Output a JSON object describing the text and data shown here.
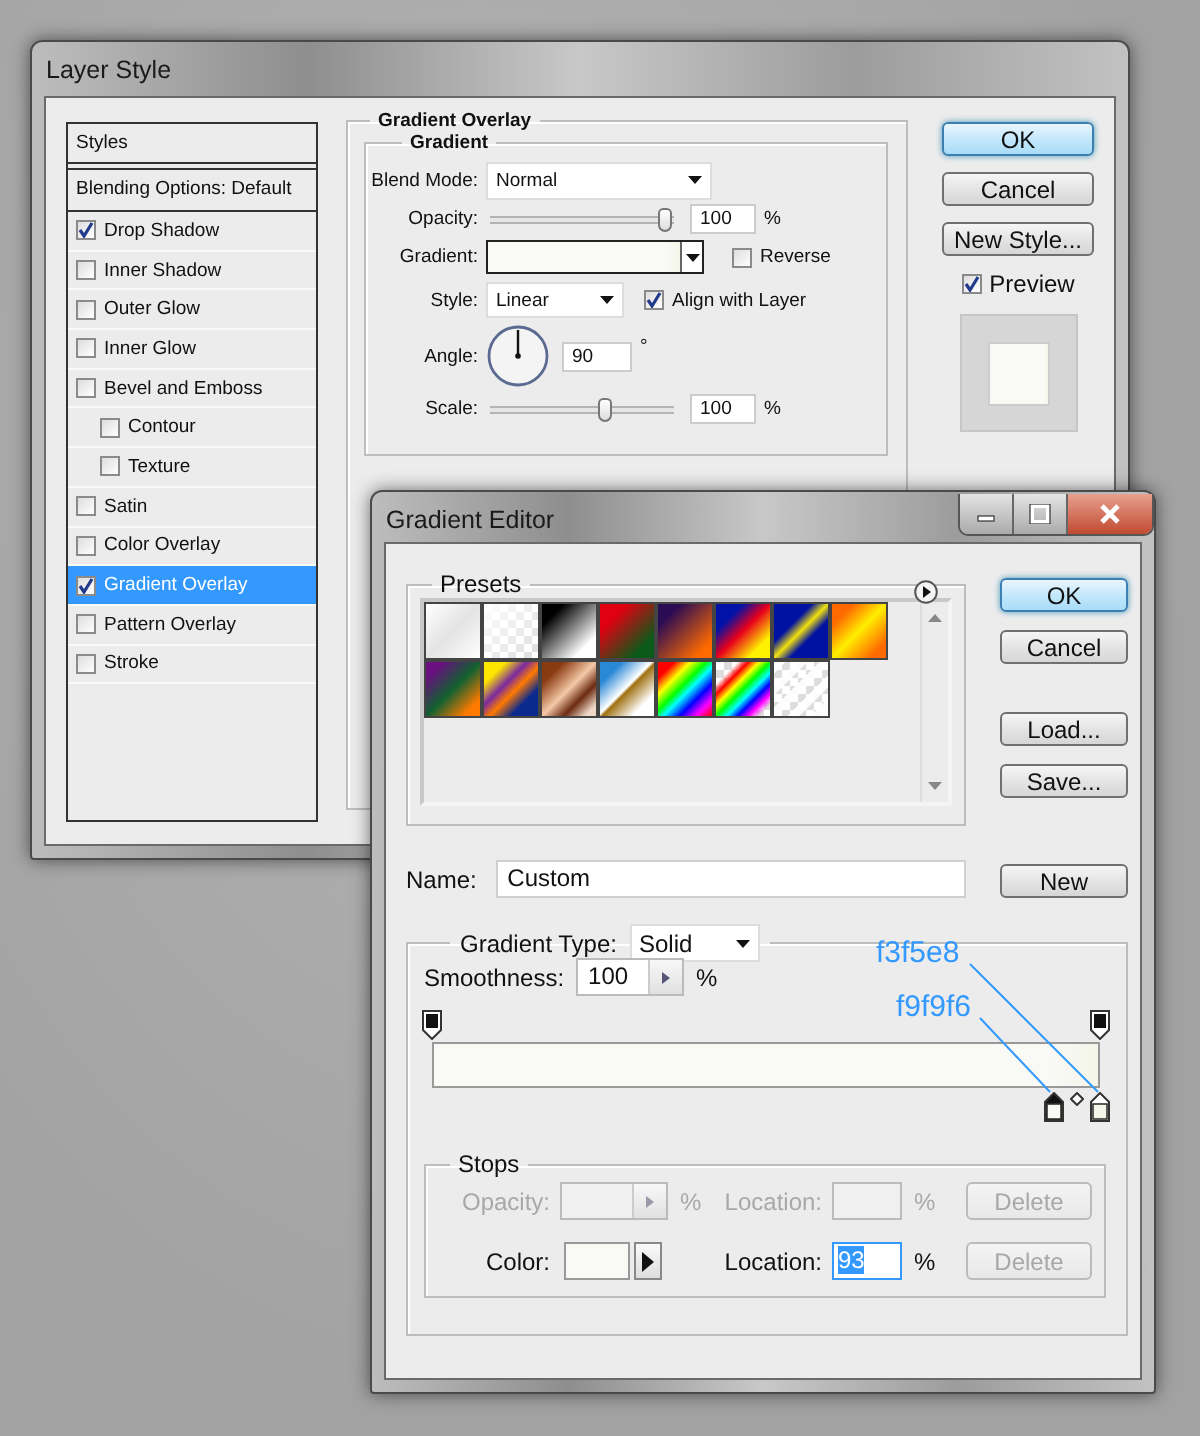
{
  "layer_style": {
    "title": "Layer Style",
    "styles_list": [
      {
        "kind": "header",
        "label": "Styles"
      },
      {
        "kind": "header",
        "label": "Blending Options: Default"
      },
      {
        "kind": "effect",
        "label": "Drop Shadow",
        "checked": true,
        "selected": false
      },
      {
        "kind": "effect",
        "label": "Inner Shadow",
        "checked": false,
        "selected": false
      },
      {
        "kind": "effect",
        "label": "Outer Glow",
        "checked": false,
        "selected": false
      },
      {
        "kind": "effect",
        "label": "Inner Glow",
        "checked": false,
        "selected": false
      },
      {
        "kind": "effect",
        "label": "Bevel and Emboss",
        "checked": false,
        "selected": false,
        "children": [
          {
            "kind": "effect",
            "label": "Contour",
            "checked": false,
            "selected": false
          },
          {
            "kind": "effect",
            "label": "Texture",
            "checked": false,
            "selected": false
          }
        ]
      },
      {
        "kind": "effect",
        "label": "Satin",
        "checked": false,
        "selected": false
      },
      {
        "kind": "effect",
        "label": "Color Overlay",
        "checked": false,
        "selected": false
      },
      {
        "kind": "effect",
        "label": "Gradient Overlay",
        "checked": true,
        "selected": true
      },
      {
        "kind": "effect",
        "label": "Pattern Overlay",
        "checked": false,
        "selected": false
      },
      {
        "kind": "effect",
        "label": "Stroke",
        "checked": false,
        "selected": false
      }
    ],
    "gradient_overlay": {
      "title": "Gradient Overlay",
      "group_title": "Gradient",
      "blend_mode": {
        "label": "Blend Mode:",
        "value": "Normal"
      },
      "opacity": {
        "label": "Opacity:",
        "level": 0.96,
        "value": "100",
        "unit": "%"
      },
      "gradient": {
        "label": "Gradient:"
      },
      "reverse": {
        "label": "Reverse",
        "checked": false
      },
      "style": {
        "label": "Style:",
        "value": "Linear"
      },
      "align": {
        "label": "Align with Layer",
        "checked": true
      },
      "angle": {
        "label": "Angle:",
        "value": "90",
        "unit": "°"
      },
      "scale": {
        "label": "Scale:",
        "level": 0.63,
        "value": "100",
        "unit": "%"
      }
    },
    "buttons": [
      {
        "label": "OK",
        "default": true
      },
      {
        "label": "Cancel",
        "default": false
      },
      {
        "label": "New Style...",
        "default": false
      }
    ],
    "preview": {
      "label": "Preview",
      "checked": true
    }
  },
  "gradient_editor": {
    "title": "Gradient Editor",
    "presets": {
      "title": "Presets"
    },
    "buttons": [
      {
        "label": "OK",
        "default": true
      },
      {
        "label": "Cancel",
        "default": false
      },
      {
        "label": "Load...",
        "default": false
      },
      {
        "label": "Save...",
        "default": false
      }
    ],
    "name": {
      "label": "Name:",
      "value": "Custom"
    },
    "new_button": {
      "label": "New"
    },
    "gradient_type": {
      "label": "Gradient Type:",
      "value": "Solid"
    },
    "smoothness": {
      "label": "Smoothness:",
      "value": "100",
      "unit": "%"
    },
    "color_stops": [
      {
        "selected": true,
        "color": "#f9f9f6"
      },
      {
        "selected": false,
        "color": "#f3f5e8"
      }
    ],
    "annotations": [
      {
        "text": "f3f5e8"
      },
      {
        "text": "f9f9f6"
      }
    ],
    "stops": {
      "title": "Stops",
      "opacity_row": {
        "disabled": true,
        "opacity_label": "Opacity:",
        "opacity_unit": "%",
        "location_label": "Location:",
        "location_unit": "%",
        "delete_label": "Delete"
      },
      "color_row": {
        "disabled": false,
        "color_label": "Color:",
        "location_label": "Location:",
        "location_value": "93",
        "location_unit": "%",
        "delete_label": "Delete",
        "delete_disabled": true
      }
    }
  }
}
